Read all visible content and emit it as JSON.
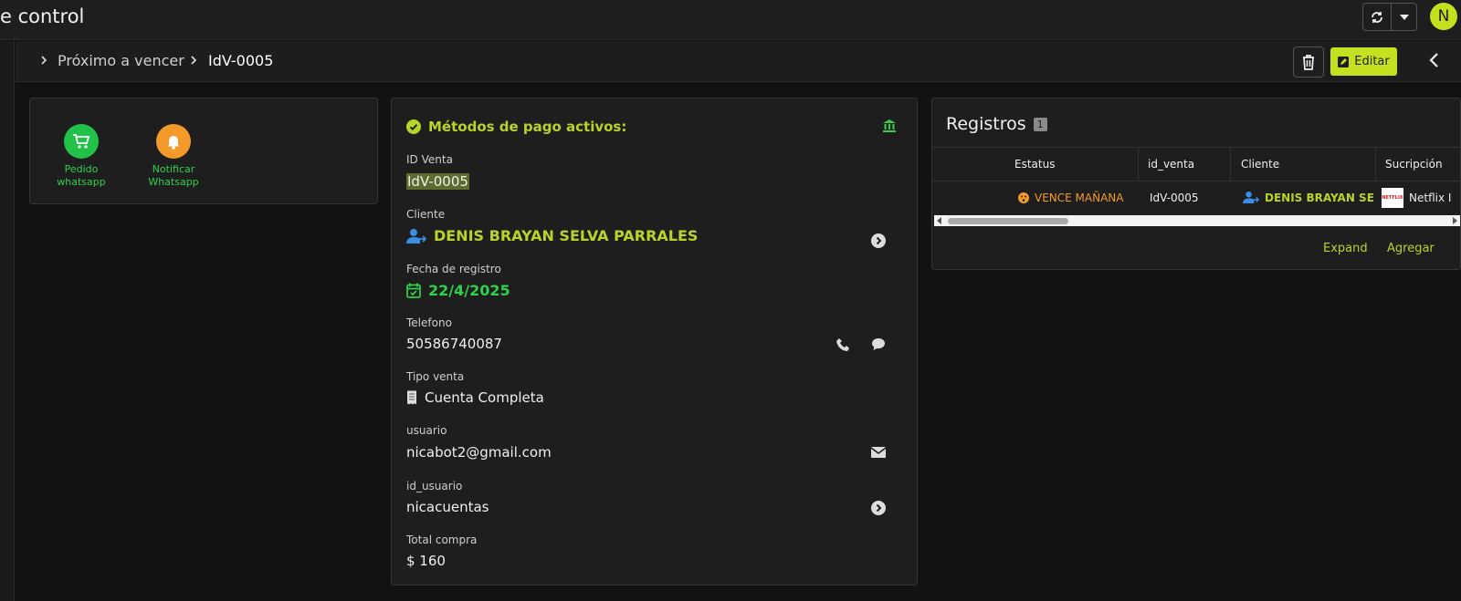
{
  "header": {
    "app_title": "e control",
    "avatar_initial": "N",
    "sync_icon": "sync-icon",
    "caret_icon": "caret-down-icon"
  },
  "breadcrumb": {
    "parent": "Próximo a vencer",
    "current": "IdV-0005"
  },
  "toolbar": {
    "delete_icon": "trash-icon",
    "edit_label": "Editar",
    "prev_icon": "chevron-left-icon",
    "next_icon": "chevron-right-icon"
  },
  "actions": [
    {
      "label": "Pedido whatsapp",
      "icon": "cart-icon",
      "color": "#22c24a"
    },
    {
      "label": "Notificar Whatsapp",
      "icon": "bell-icon",
      "color": "#f39a2b"
    }
  ],
  "detail": {
    "title": "Métodos de pago activos:",
    "fields": {
      "id_venta": {
        "label": "ID Venta",
        "value": "IdV-0005"
      },
      "cliente": {
        "label": "Cliente",
        "value": "DENIS BRAYAN SELVA PARRALES"
      },
      "fecha": {
        "label": "Fecha de registro",
        "value": "22/4/2025"
      },
      "telefono": {
        "label": "Telefono",
        "value": "50586740087"
      },
      "tipo_venta": {
        "label": "Tipo venta",
        "value": "Cuenta Completa"
      },
      "usuario": {
        "label": "usuario",
        "value": "nicabot2@gmail.com"
      },
      "id_usuario": {
        "label": "id_usuario",
        "value": "nicacuentas"
      },
      "total": {
        "label": "Total compra",
        "value": "$ 160"
      }
    }
  },
  "registros": {
    "title": "Registros",
    "count": "1",
    "columns": [
      "Estatus",
      "id_venta",
      "Cliente",
      "Sucripción"
    ],
    "rows": [
      {
        "estatus": "VENCE MAÑANA",
        "id_venta": "IdV-0005",
        "cliente": "DENIS BRAYAN SE",
        "suscripcion": "Netflix I",
        "logo_text": "NETFLIX"
      }
    ],
    "expand_label": "Expand",
    "add_label": "Agregar"
  },
  "colors": {
    "accent": "#c4e01f",
    "green": "#2fd04a",
    "warning": "#f39a2b",
    "blue": "#3a8ee6"
  }
}
